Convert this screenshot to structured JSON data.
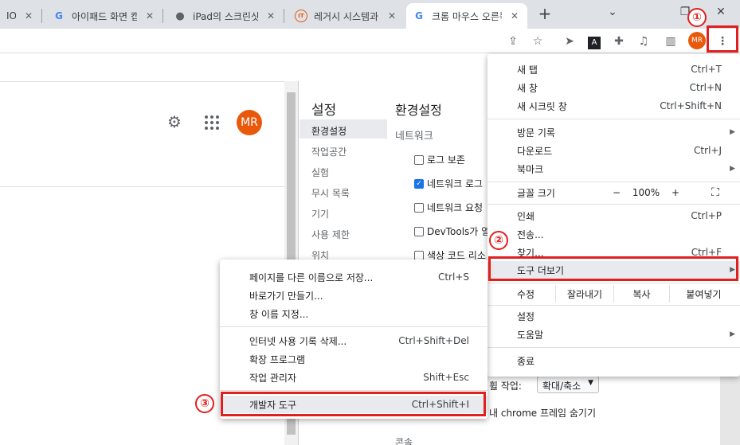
{
  "tabs": [
    {
      "title": "ION",
      "favicon": "none"
    },
    {
      "title": "아이패드 화면 캡처",
      "favicon": "google-icon"
    },
    {
      "title": "iPad의 스크린샷",
      "favicon": "apple-icon"
    },
    {
      "title": "레거시 시스템과",
      "favicon": "it-icon"
    },
    {
      "title": "크롬 마우스 오른쪽",
      "favicon": "google-icon"
    }
  ],
  "toolbar": {
    "avatar": "MR"
  },
  "page": {
    "avatar": "MR"
  },
  "devtools": {
    "title": "설정",
    "sidebar": [
      "환경설정",
      "작업공간",
      "실험",
      "무시 목록",
      "기기",
      "사용 제한",
      "위치"
    ],
    "heading": "환경설정",
    "section": "네트워크",
    "checks": [
      {
        "label": "로그 보존",
        "checked": false
      },
      {
        "label": "네트워크 로그",
        "checked": true
      },
      {
        "label": "네트워크 요청",
        "checked": false
      },
      {
        "label": "DevTools가 열",
        "checked": false
      },
      {
        "label": "색상 코드 리소",
        "checked": false
      }
    ],
    "zoom_label": "휠 작업:",
    "zoom_value": "확대/축소",
    "frame_text": "내 chrome 프레임 숨기기",
    "console": "콘솔"
  },
  "menu": {
    "new_tab": "새 탭",
    "new_tab_sc": "Ctrl+T",
    "new_window": "새 창",
    "new_window_sc": "Ctrl+N",
    "incognito": "새 시크릿 창",
    "incognito_sc": "Ctrl+Shift+N",
    "history": "방문 기록",
    "downloads": "다운로드",
    "downloads_sc": "Ctrl+J",
    "bookmarks": "북마크",
    "zoom": "글꼴 크기",
    "zoom_minus": "−",
    "zoom_value": "100%",
    "zoom_plus": "+",
    "print": "인쇄",
    "print_sc": "Ctrl+P",
    "cast": "전송...",
    "find": "찾기...",
    "find_sc": "Ctrl+F",
    "more_tools": "도구 더보기",
    "edit": "수정",
    "cut": "잘라내기",
    "copy": "복사",
    "paste": "붙여넣기",
    "settings": "설정",
    "help": "도움말",
    "exit": "종료"
  },
  "submenu": {
    "save_as": "페이지를 다른 이름으로 저장...",
    "save_as_sc": "Ctrl+S",
    "shortcut": "바로가기 만들기...",
    "name_window": "창 이름 지정...",
    "clear": "인터넷 사용 기록 삭제...",
    "clear_sc": "Ctrl+Shift+Del",
    "extensions": "확장 프로그램",
    "task_manager": "작업 관리자",
    "task_manager_sc": "Shift+Esc",
    "dev_tools": "개발자 도구",
    "dev_tools_sc": "Ctrl+Shift+I"
  },
  "annotations": {
    "badge1": "①",
    "badge2": "②",
    "badge3": "③"
  },
  "colors": {
    "highlight": "#e01f1f",
    "avatar": "#e8590c",
    "checkbox": "#1a73e8"
  }
}
